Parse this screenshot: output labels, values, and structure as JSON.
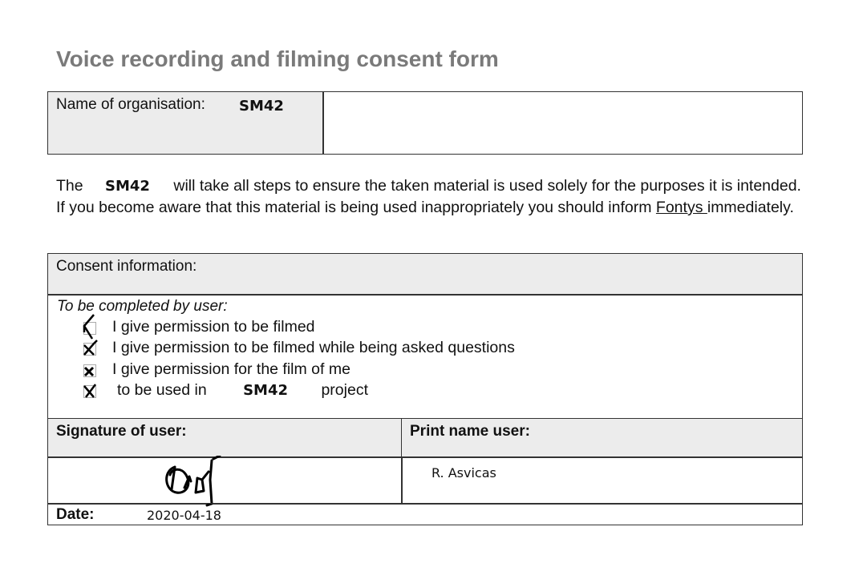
{
  "title": "Voice recording and filming consent form",
  "organisation": {
    "label": "Name of organisation:",
    "value": "SM42"
  },
  "paragraph": {
    "the": "The",
    "org": "SM42",
    "rest1": "will take all steps to ensure the taken material is used solely for the purposes it is intended. If you become aware that this material is being used inappropriately you should inform",
    "link": "Fontys ",
    "rest2": "immediately."
  },
  "consent": {
    "header": "Consent information:",
    "subheader": "To be completed by user:",
    "items": [
      {
        "label": "I give permission to be filmed",
        "checked": true
      },
      {
        "label": "I give permission to be filmed while being asked questions",
        "checked": true
      },
      {
        "label": "I give permission for the film of me",
        "checked": true
      },
      {
        "label": "to be used in",
        "project": "SM42",
        "suffix": "project",
        "checked": true
      }
    ]
  },
  "signature": {
    "label": "Signature of user:"
  },
  "print_name": {
    "label": "Print name user:",
    "value": "R. Asvicas"
  },
  "date": {
    "label": "Date:",
    "value": "2020-04-18"
  }
}
